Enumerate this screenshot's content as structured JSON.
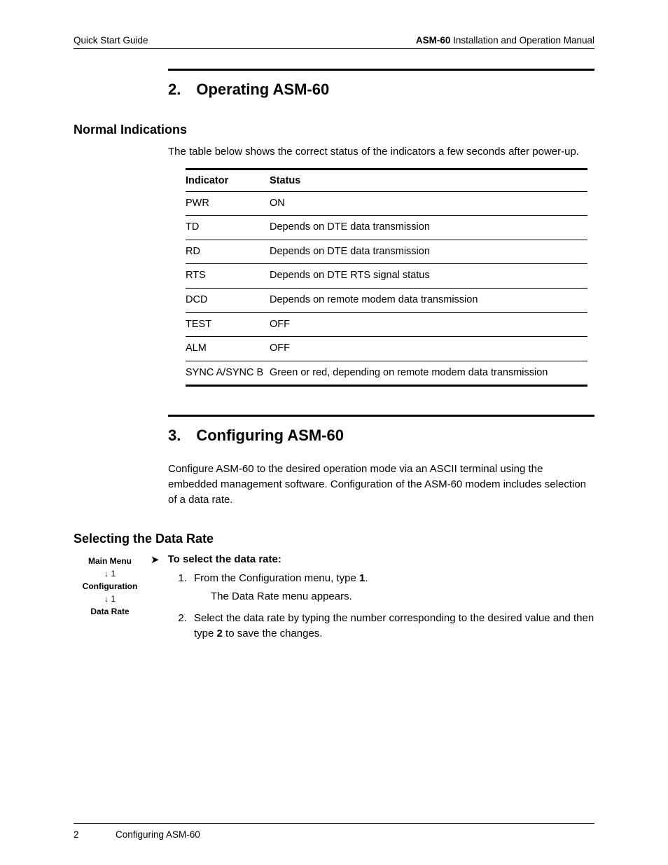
{
  "header": {
    "left": "Quick Start Guide",
    "right_bold": "ASM-60",
    "right_rest": " Installation and Operation Manual"
  },
  "section2": {
    "title": "2. Operating ASM-60",
    "subhead": "Normal Indications",
    "intro": "The table below shows the correct status of the indicators a few seconds after power-up.",
    "table": {
      "headers": [
        "Indicator",
        "Status"
      ],
      "rows": [
        [
          "PWR",
          "ON"
        ],
        [
          "TD",
          "Depends on DTE data transmission"
        ],
        [
          "RD",
          "Depends on DTE data transmission"
        ],
        [
          "RTS",
          "Depends on DTE RTS signal status"
        ],
        [
          "DCD",
          "Depends on remote modem data transmission"
        ],
        [
          "TEST",
          "OFF"
        ],
        [
          "ALM",
          "OFF"
        ],
        [
          "SYNC A/SYNC B",
          "Green or red, depending on remote modem data transmission"
        ]
      ]
    }
  },
  "section3": {
    "title": "3. Configuring ASM-60",
    "intro": "Configure ASM-60 to the desired operation mode via an ASCII terminal using the embedded management software. Configuration of the ASM-60 modem includes selection of a data rate.",
    "subhead": "Selecting the Data Rate",
    "nav": {
      "l1": "Main Menu",
      "a1": "↓ 1",
      "l2": "Configuration",
      "a2": "↓ 1",
      "l3": "Data Rate"
    },
    "proc_title": "To select the data rate:",
    "steps": {
      "s1_a": "From the Configuration menu, type ",
      "s1_b": "1",
      "s1_c": ".",
      "s1_sub": "The Data Rate menu appears.",
      "s2_a": "Select the data rate by typing the number corresponding to the desired value and then type ",
      "s2_b": "2",
      "s2_c": " to save the changes."
    }
  },
  "footer": {
    "page": "2",
    "text": "Configuring ASM-60"
  }
}
